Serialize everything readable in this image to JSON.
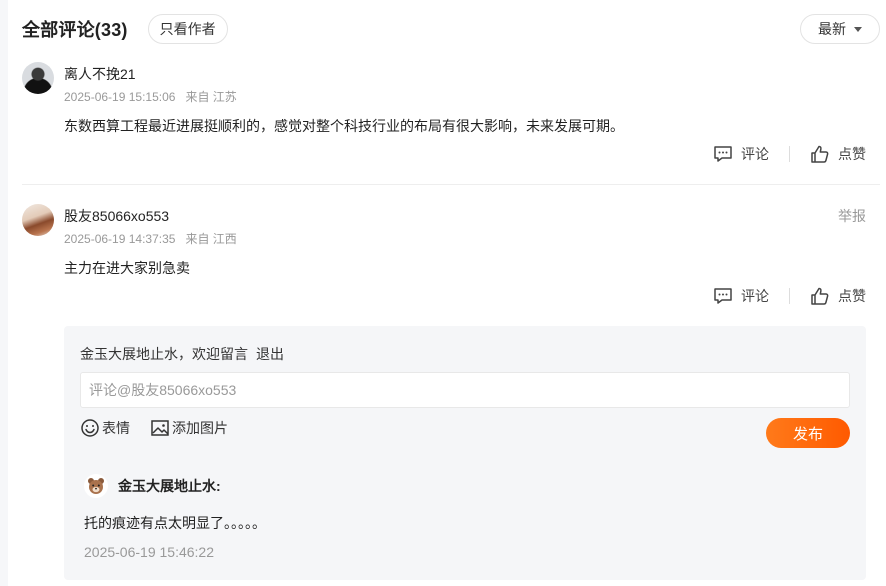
{
  "header": {
    "title": "全部评论(33)",
    "author_only": "只看作者",
    "sort": "最新"
  },
  "comments": [
    {
      "user": "离人不挽21",
      "time": "2025-06-19 15:15:06",
      "location": "来自 江苏",
      "content": "东数西算工程最近进展挺顺利的，感觉对整个科技行业的布局有很大影响，未来发展可期。",
      "reply_label": "评论",
      "like_label": "点赞"
    },
    {
      "user": "股友85066xo553",
      "time": "2025-06-19 14:37:35",
      "location": "来自 江西",
      "content": "主力在进大家别急卖",
      "report_label": "举报",
      "reply_label": "评论",
      "like_label": "点赞"
    }
  ],
  "reply_box": {
    "welcome": "金玉大展地止水，欢迎留言",
    "logout": "退出",
    "placeholder": "评论@股友85066xo553",
    "emoji_label": "表情",
    "image_label": "添加图片",
    "publish_label": "发布",
    "my_reply": {
      "user": "金玉大展地止水:",
      "content": "托的痕迹有点太明显了。。。。。",
      "time": "2025-06-19 15:46:22"
    }
  },
  "colors": {
    "accent": "#ff6a0d",
    "muted_text": "#999999",
    "panel_bg": "#f5f6f8"
  }
}
